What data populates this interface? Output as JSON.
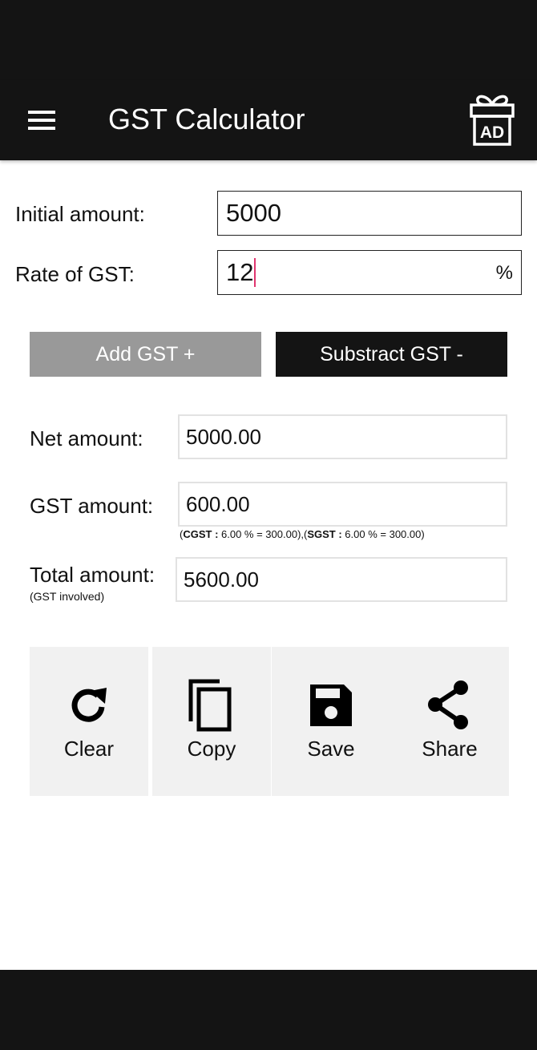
{
  "app_bar": {
    "title": "GST Calculator",
    "menu_icon": "hamburger-menu-icon",
    "ad_icon": "gift-ad-icon",
    "ad_label": "AD"
  },
  "inputs": {
    "initial_amount_label": "Initial amount:",
    "initial_amount_value": "5000",
    "rate_label": "Rate of GST:",
    "rate_value": "12",
    "rate_suffix": "%"
  },
  "buttons": {
    "add_gst": "Add GST +",
    "subtract_gst": "Substract GST -"
  },
  "results": {
    "net_label": "Net amount:",
    "net_value": "5000.00",
    "gst_label": "GST amount:",
    "gst_value": "600.00",
    "breakdown_cgst_key": "CGST :",
    "breakdown_cgst_rest": " 6.00 % = 300.00),(",
    "breakdown_sgst_key": "SGST :",
    "breakdown_sgst_rest": " 6.00 % = 300.00)",
    "breakdown_open": "(",
    "total_label": "Total amount:",
    "total_sublabel": "(GST involved)",
    "total_value": "5600.00"
  },
  "actions": [
    {
      "label": "Clear",
      "icon": "refresh-icon"
    },
    {
      "label": "Copy",
      "icon": "copy-icon"
    },
    {
      "label": "Save",
      "icon": "floppy-save-icon"
    },
    {
      "label": "Share",
      "icon": "share-icon"
    }
  ],
  "colors": {
    "bar_bg": "#141414",
    "add_btn_bg": "#999999",
    "action_bg": "#f1f1f1",
    "caret": "#e0356f"
  }
}
